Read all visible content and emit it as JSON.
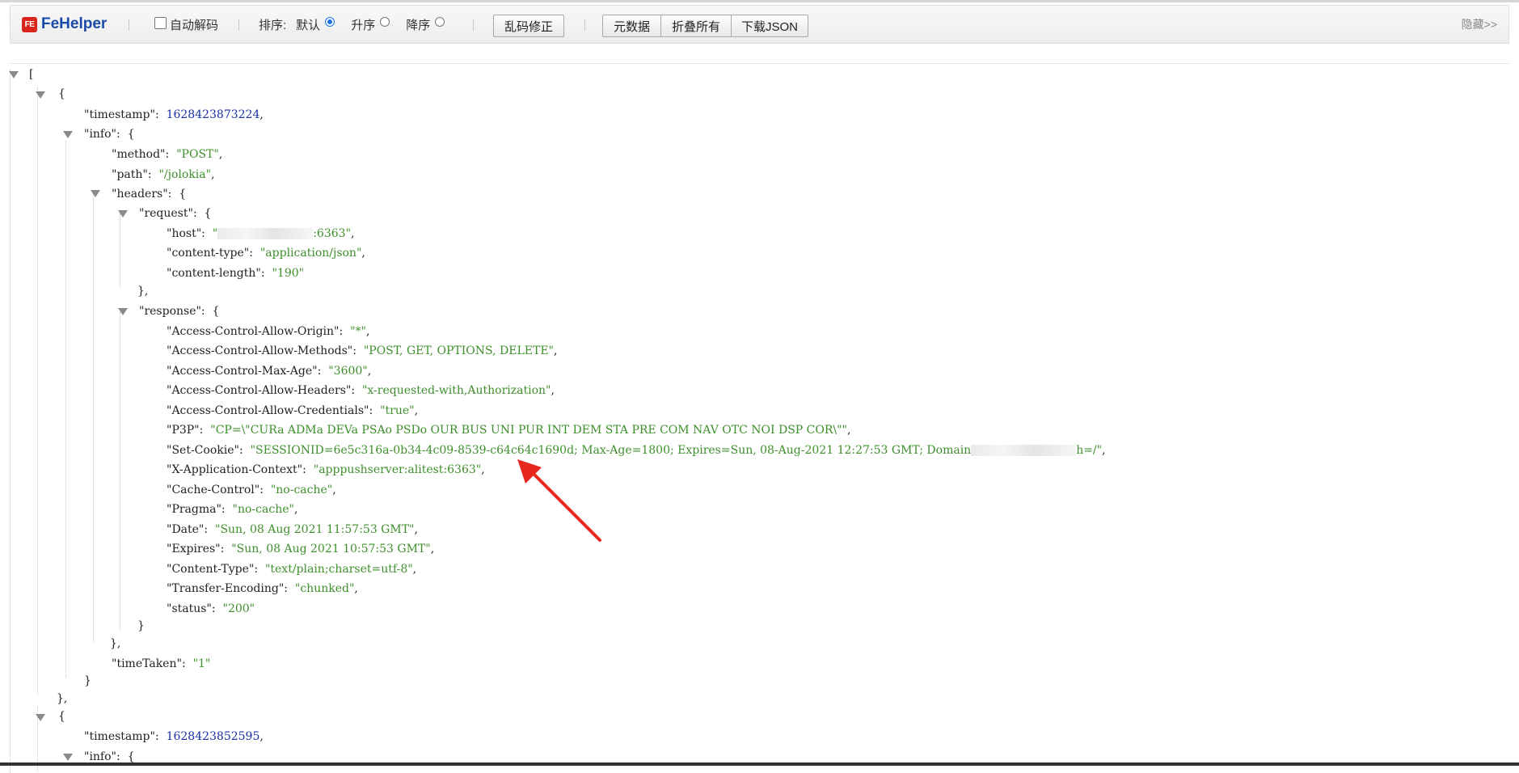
{
  "toolbar": {
    "logo_mark": "FE",
    "logo_text": "FeHelper",
    "auto_decode_label": "自动解码",
    "sort_label": "排序:",
    "sort_default_label": "默认",
    "sort_asc_label": "升序",
    "sort_desc_label": "降序",
    "fix_garbled_label": "乱码修正",
    "raw_data_label": "元数据",
    "collapse_all_label": "折叠所有",
    "download_json_label": "下载JSON",
    "hide_label": "隐藏>>"
  },
  "json": {
    "open_bracket": "[",
    "records": [
      {
        "timestamp": "1628423873224",
        "method": "\"POST\"",
        "path": "\"/jolokia\"",
        "request": {
          "host_suffix": ":6363\"",
          "content_type": "\"application/json\"",
          "content_length": "\"190\""
        },
        "response": {
          "acao": "\"*\"",
          "acam": "\"POST, GET, OPTIONS, DELETE\"",
          "acma": "\"3600\"",
          "acah": "\"x-requested-with,Authorization\"",
          "acac": "\"true\"",
          "p3p": "\"CP=\\\"CURa ADMa DEVa PSAo PSDo OUR BUS UNI PUR INT DEM STA PRE COM NAV OTC NOI DSP COR\\\"\"",
          "set_cookie_head": "\"SESSIONID=6e5c316a-0b34-4c09-8539-c64c64c1690d; Max-Age=1800; Expires=Sun, 08-Aug-2021 12:27:53 GMT; Domain",
          "set_cookie_tail": "h=/\"",
          "x_app_context": "\"apppushserver:alitest:6363\"",
          "cache_control": "\"no-cache\"",
          "pragma": "\"no-cache\"",
          "date": "\"Sun, 08 Aug 2021 11:57:53 GMT\"",
          "expires": "\"Sun, 08 Aug 2021 10:57:53 GMT\"",
          "content_type": "\"text/plain;charset=utf-8\"",
          "transfer_encoding": "\"chunked\"",
          "status": "\"200\""
        },
        "time_taken": "\"1\""
      },
      {
        "timestamp": "1628423852595"
      }
    ]
  },
  "keys": {
    "timestamp": "\"timestamp\"",
    "info": "\"info\"",
    "method": "\"method\"",
    "path": "\"path\"",
    "headers": "\"headers\"",
    "request": "\"request\"",
    "host": "\"host\"",
    "content_type": "\"content-type\"",
    "content_length": "\"content-length\"",
    "response": "\"response\"",
    "acao": "\"Access-Control-Allow-Origin\"",
    "acam": "\"Access-Control-Allow-Methods\"",
    "acma": "\"Access-Control-Max-Age\"",
    "acah": "\"Access-Control-Allow-Headers\"",
    "acac": "\"Access-Control-Allow-Credentials\"",
    "p3p": "\"P3P\"",
    "set_cookie": "\"Set-Cookie\"",
    "x_app_context": "\"X-Application-Context\"",
    "cache_control": "\"Cache-Control\"",
    "pragma": "\"Pragma\"",
    "date": "\"Date\"",
    "expires": "\"Expires\"",
    "content_type_cap": "\"Content-Type\"",
    "transfer_encoding": "\"Transfer-Encoding\"",
    "status": "\"status\"",
    "time_taken": "\"timeTaken\""
  },
  "colors": {
    "string": "#3e8f2c",
    "number": "#1a2fa8",
    "annotation_arrow": "#e8281e",
    "logo": "#d9251d"
  },
  "icons": {
    "expand_toggle": "triangle-down-icon",
    "annotation": "red-arrow-icon"
  }
}
